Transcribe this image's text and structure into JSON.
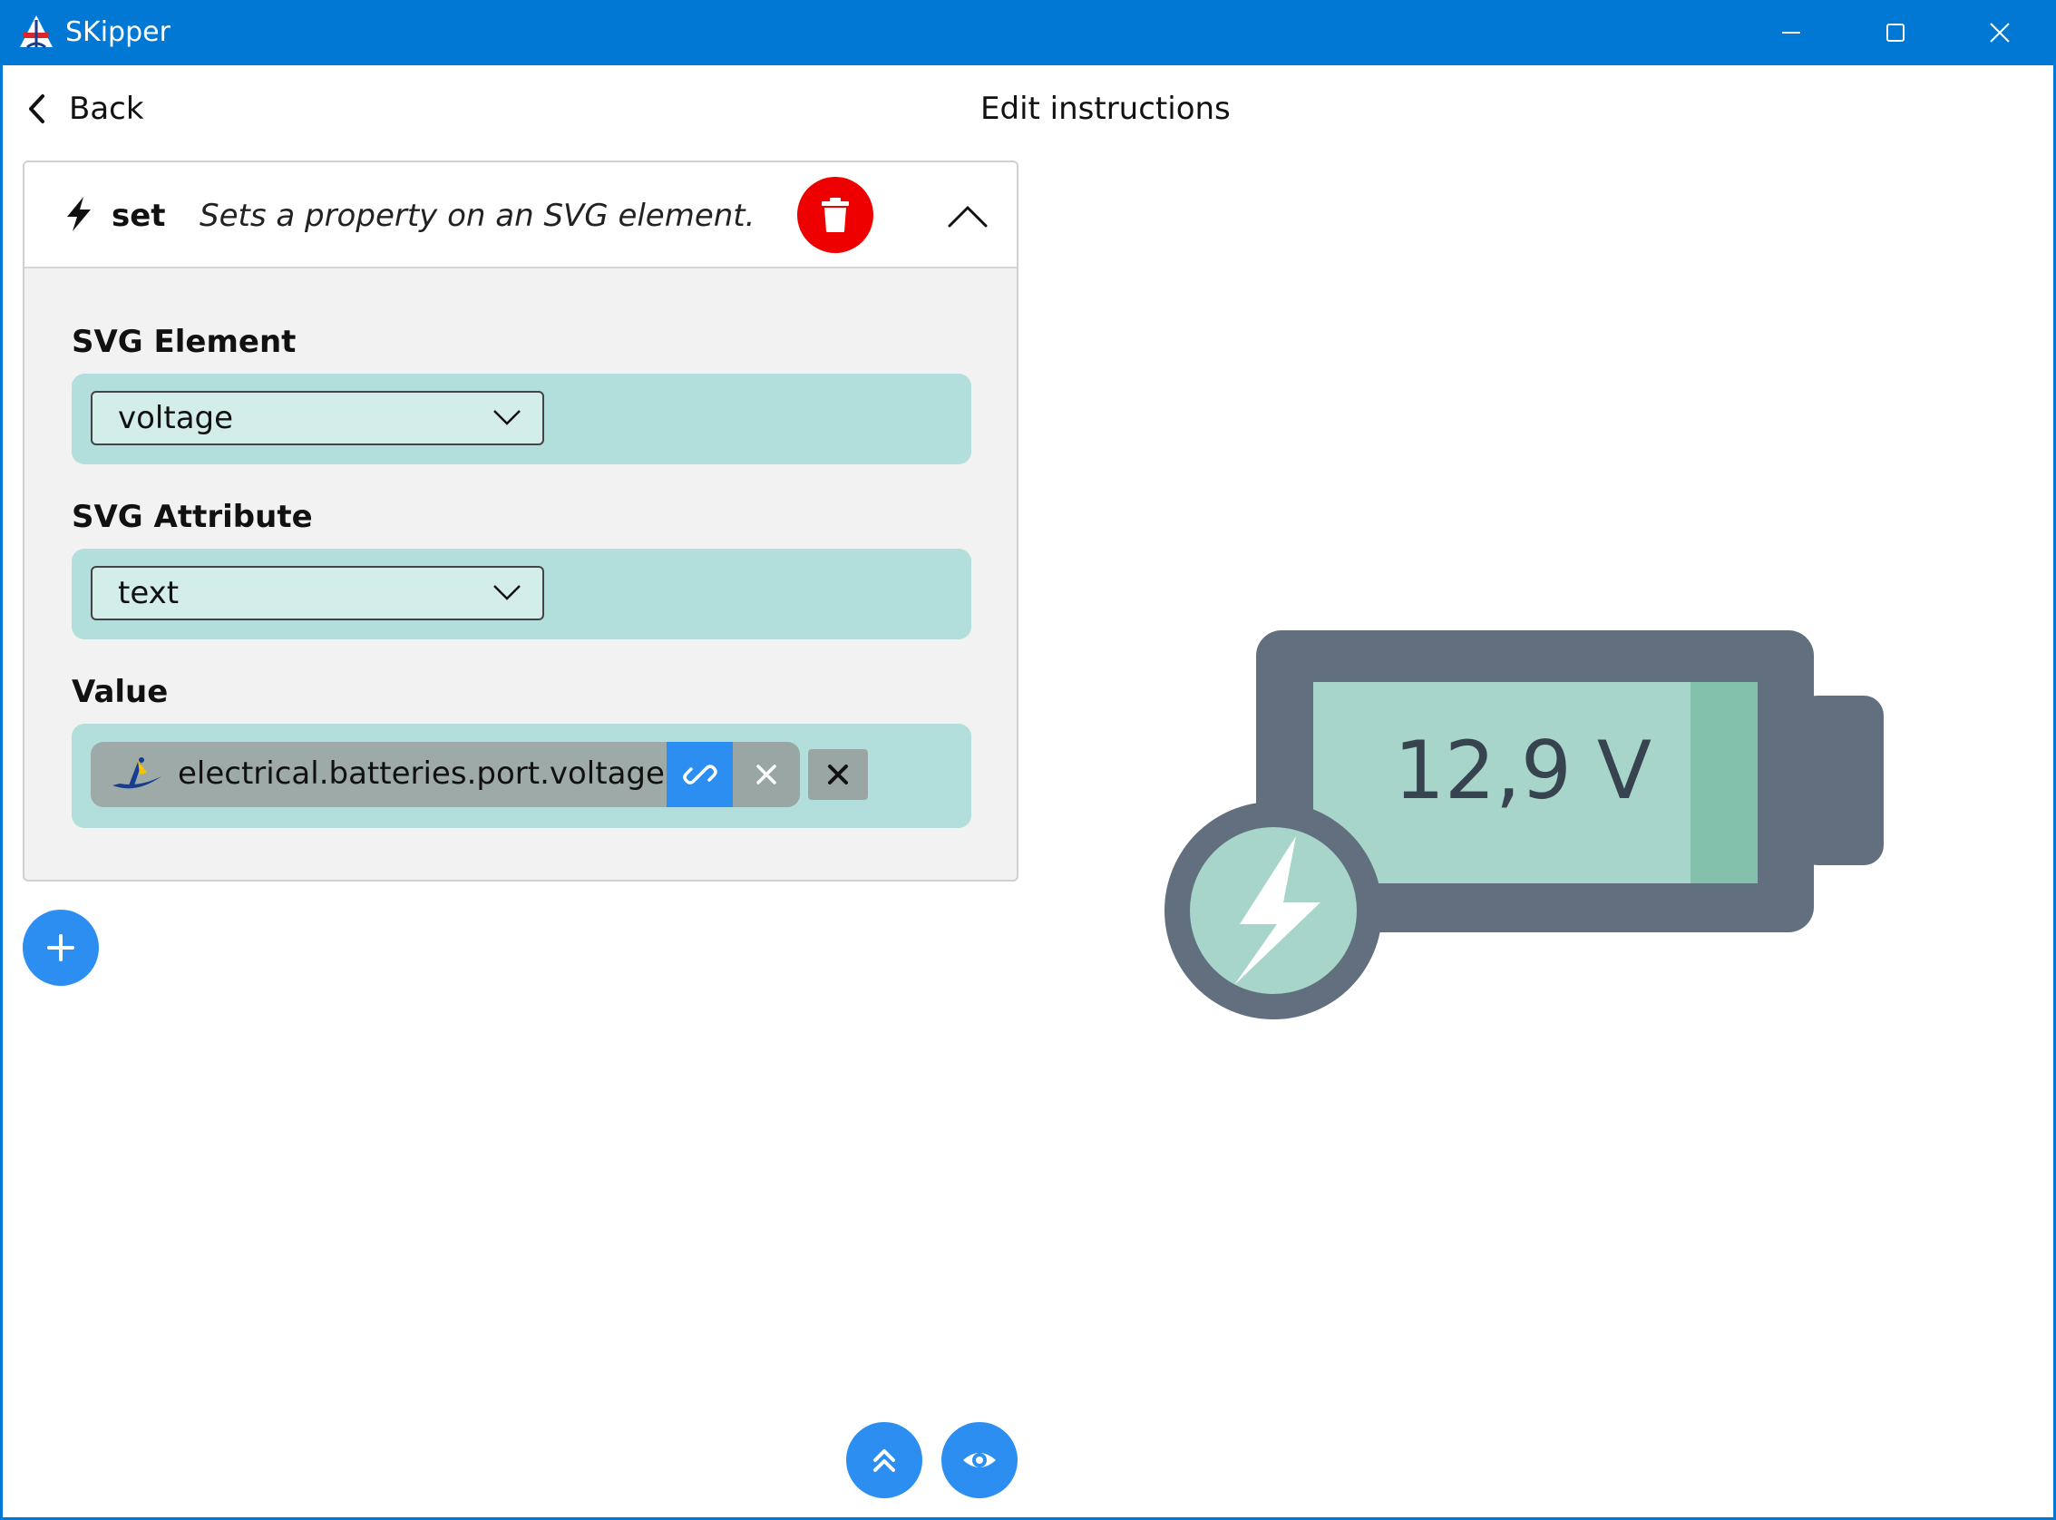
{
  "window": {
    "title": "SKipper",
    "controls": [
      "minimize-icon",
      "maximize-icon",
      "close-icon"
    ]
  },
  "header": {
    "back_label": "Back",
    "page_title": "Edit instructions"
  },
  "instruction": {
    "icon": "bolt-icon",
    "name": "set",
    "description": "Sets a property on an SVG element.",
    "delete_icon": "trash-icon",
    "collapse_icon": "chevron-up-icon",
    "fields": {
      "svg_element": {
        "label": "SVG Element",
        "value": "voltage"
      },
      "svg_attribute": {
        "label": "SVG Attribute",
        "value": "text"
      },
      "value": {
        "label": "Value",
        "path": "electrical.batteries.port.voltage",
        "source_icon": "signalk-icon",
        "link_icon": "link-icon",
        "remove_icon": "close-icon",
        "clear_icon": "close-icon"
      }
    }
  },
  "preview": {
    "voltage": "12,9 V",
    "colors": {
      "body": "#616f7e",
      "screen": "#a8d5c9",
      "level": "#84c1ac",
      "bolt": "#ffffff"
    }
  },
  "actions": {
    "add_icon": "plus-icon",
    "scroll_top_icon": "double-chevron-up-icon",
    "preview_icon": "eye-icon"
  },
  "colors": {
    "titlebar": "#0078d4",
    "accent": "#2b8ef0",
    "danger": "#ee0000",
    "field_bg": "#b2dfdb"
  }
}
